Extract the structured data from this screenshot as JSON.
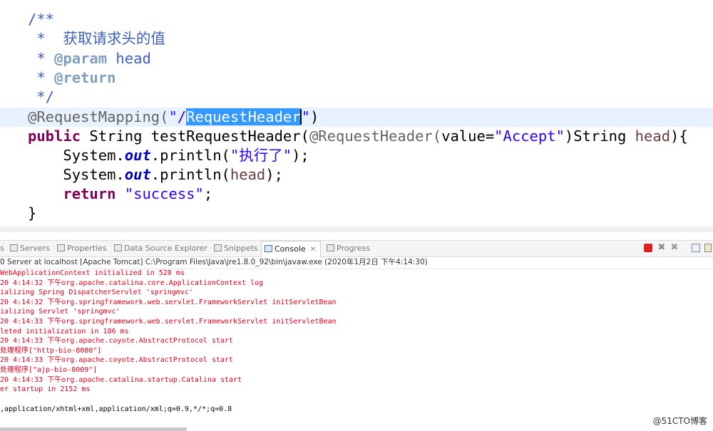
{
  "editor": {
    "lines": {
      "l1": "/**",
      "l2": " *  获取请求头的值",
      "l3_star": " * ",
      "l3_tag": "@param",
      "l3_rest": " head",
      "l4_star": " * ",
      "l4_tag": "@return",
      "l5": " */",
      "l6_ann": "@RequestMapping(",
      "l6_q1": "\"/",
      "l6_sel": "RequestHeader",
      "l6_q2": "\"",
      "l6_close": ")",
      "l7_kw": "public",
      "l7_a": " String testRequestHeader(",
      "l7_ann": "@RequestHeader(",
      "l7_b": "value=",
      "l7_str": "\"Accept\"",
      "l7_c": ")String ",
      "l7_var": "head",
      "l7_d": "){",
      "l8_a": "    System.",
      "l8_fld": "out",
      "l8_b": ".println(",
      "l8_str": "\"执行了\"",
      "l8_c": ");",
      "l9_a": "    System.",
      "l9_fld": "out",
      "l9_b": ".println(",
      "l9_var": "head",
      "l9_c": ");",
      "l10_kw": "    return",
      "l10_sp": " ",
      "l10_str": "\"success\"",
      "l10_c": ";",
      "l11": "}"
    }
  },
  "views": {
    "tabs": [
      {
        "label": "s"
      },
      {
        "label": "Servers"
      },
      {
        "label": "Properties"
      },
      {
        "label": "Data Source Explorer"
      },
      {
        "label": "Snippets"
      },
      {
        "label": "Console"
      },
      {
        "label": "Progress"
      }
    ],
    "close_glyph": "✕"
  },
  "console": {
    "description": "0 Server at localhost [Apache Tomcat] C:\\Program Files\\Java\\jre1.8.0_92\\bin\\javaw.exe (2020年1月2日 下午4:14:30)",
    "lines": [
      "WebApplicationContext initialized in 528 ms",
      "20 4:14:32 下午org.apache.catalina.core.ApplicationContext log",
      "ializing Spring DispatcherServlet 'springmvc'",
      "20 4:14:32 下午org.springframework.web.servlet.FrameworkServlet initServletBean",
      "ializing Servlet 'springmvc'",
      "20 4:14:33 下午org.springframework.web.servlet.FrameworkServlet initServletBean",
      "leted initialization in 186 ms",
      "20 4:14:33 下午org.apache.coyote.AbstractProtocol start",
      "处理程序[\"http-bio-8080\"]",
      "20 4:14:33 下午org.apache.coyote.AbstractProtocol start",
      "处理程序[\"ajp-bio-8009\"]",
      "20 4:14:33 下午org.apache.catalina.startup.Catalina start",
      "er startup in 2152 ms"
    ],
    "output_line": ",application/xhtml+xml,application/xml;q=0.9,*/*;q=0.8"
  },
  "watermark": "@51CTO博客",
  "colors": {
    "comment": "#3f5fbf",
    "javadoc_tag": "#7f9fbf",
    "keyword": "#7f0055",
    "string": "#2a00ff",
    "annotation": "#646464",
    "console_error": "#e0001b",
    "selection": "#3399ff",
    "current_line": "#e8f2fe"
  },
  "icons": [
    "servers-icon",
    "properties-icon",
    "data-source-explorer-icon",
    "snippets-icon",
    "console-icon",
    "progress-icon",
    "terminate-icon",
    "remove-launch-icon",
    "remove-all-terminated-icon",
    "scroll-lock-icon",
    "pin-console-icon"
  ]
}
